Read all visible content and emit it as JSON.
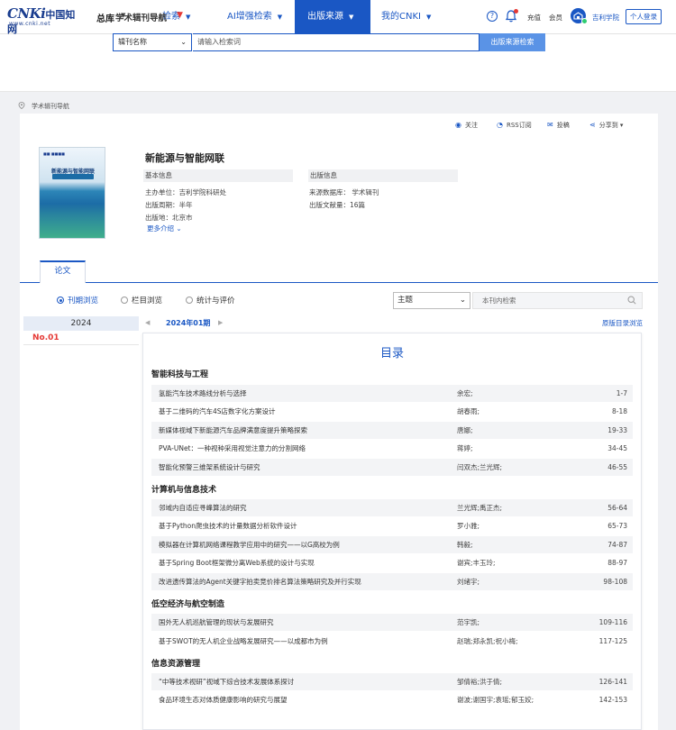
{
  "logo": {
    "brand": "CNKi",
    "cn": "中国知网",
    "url": "www.cnki.net"
  },
  "nav": {
    "library": "总库",
    "items": [
      {
        "label": "检索"
      },
      {
        "label": "AI增强检索"
      },
      {
        "label": "出版来源"
      },
      {
        "label": "我的CNKI"
      }
    ],
    "recharge": "充值",
    "member": "会员",
    "user": "吉利学院",
    "login": "个人登录"
  },
  "search": {
    "title": "学术辑刊导航",
    "field": "辑刊名称",
    "placeholder": "请输入检索词",
    "button": "出版来源检索"
  },
  "breadcrumb": "学术辑刊导航",
  "actions": {
    "follow": "关注",
    "rss": "RSS订阅",
    "submit": "投稿",
    "share": "分享到"
  },
  "journal": {
    "title": "新能源与智能网联",
    "cover_title": "新能源与智能网联",
    "basic_head": "基本信息",
    "publish_head": "出版信息",
    "host": "主办单位：吉利学院科研处",
    "cycle": "出版周期：半年",
    "place": "出版地：北京市",
    "database": "来源数据库：  学术辑刊",
    "count": "出版文献量：16篇",
    "more": "更多介绍"
  },
  "tabs": {
    "papers": "论文"
  },
  "browse": {
    "by_issue": "刊期浏览",
    "by_column": "栏目浏览",
    "stats": "统计与评价",
    "filter": "主题",
    "in_search": "本刊内检索"
  },
  "year": {
    "label": "2024",
    "issue": "No.01"
  },
  "period": {
    "current": "2024年01期",
    "original": "原版目录浏览"
  },
  "toc": {
    "title": "目录",
    "sections": [
      {
        "title": "智能科技与工程",
        "rows": [
          {
            "title": "氢能汽车技术路线分析与选择",
            "author": "余宏;",
            "pages": "1-7"
          },
          {
            "title": "基于二维码的汽车4S店数字化方案设计",
            "author": "胡春雨;",
            "pages": "8-18"
          },
          {
            "title": "新媒体视域下新能源汽车品牌满意度提升策略探索",
            "author": "唐娜;",
            "pages": "19-33"
          },
          {
            "title": "PVA-UNet：一种视种采用视觉注意力的分割网络",
            "author": "蒋婷;",
            "pages": "34-45"
          },
          {
            "title": "智能化预警三维架系统设计与研究",
            "author": "闫双杰;兰光辉;",
            "pages": "46-55"
          }
        ]
      },
      {
        "title": "计算机与信息技术",
        "rows": [
          {
            "title": "邻域内自适应寻峰算法的研究",
            "author": "兰光辉;禹正杰;",
            "pages": "56-64"
          },
          {
            "title": "基于Python爬虫技术的计量数据分析软件设计",
            "author": "罗小雅;",
            "pages": "65-73"
          },
          {
            "title": "模拟器在计算机网络课程教学应用中的研究——以G高校为例",
            "author": "韩毅;",
            "pages": "74-87"
          },
          {
            "title": "基于Spring Boot框架微分离Web系统的设计与实现",
            "author": "谢宾;丰玉玲;",
            "pages": "88-97"
          },
          {
            "title": "改进遗传算法的Agent关键字拍卖竞价排名算法策略研究及并行实现",
            "author": "刘绪宇;",
            "pages": "98-108"
          }
        ]
      },
      {
        "title": "低空经济与航空制造",
        "rows": [
          {
            "title": "国外无人机巡航管理的现状与发展研究",
            "author": "范宇凯;",
            "pages": "109-116"
          },
          {
            "title": "基于SWOT的无人机企业战略发展研究——以成都市为例",
            "author": "赵瑞;郑永凯;祝小梅;",
            "pages": "117-125"
          }
        ]
      },
      {
        "title": "信息资源管理",
        "rows": [
          {
            "title": "“中等技术视研”视域下综合技术发展体系探讨",
            "author": "邹倩裕;洪于倩;",
            "pages": "126-141"
          },
          {
            "title": "食品环境生态对体质健康影响的研究与展望",
            "author": "谢波;谢国宇;袁瑶;郁玉姣;",
            "pages": "142-153"
          }
        ]
      }
    ]
  }
}
